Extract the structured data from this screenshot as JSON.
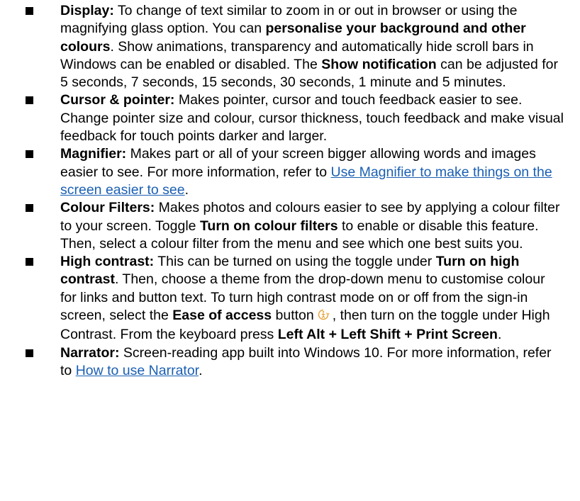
{
  "items": [
    {
      "id": "display",
      "title": "Display:",
      "t1": " To change of text similar to zoom in or out in browser or using the magnifying glass option. You can ",
      "b1": "personalise your background and other colours",
      "t2": ". Show animations, transparency and automatically hide scroll bars in Windows can be enabled or disabled. The ",
      "b2": "Show notification",
      "t3": " can be adjusted for 5 seconds, 7 seconds, 15 seconds, 30 seconds, 1 minute and 5 minutes."
    },
    {
      "id": "cursor",
      "title": "Cursor & pointer:",
      "t1": " Makes pointer, cursor and touch feedback easier to see. Change pointer size and colour, cursor thickness, touch feedback and make visual feedback for touch points darker and larger."
    },
    {
      "id": "magnifier",
      "title": "Magnifier:",
      "t1": " Makes part or all of your screen bigger allowing words and images easier to see. For more information, refer to ",
      "link": "Use Magnifier to make things on the screen easier to see",
      "t2": "."
    },
    {
      "id": "colour-filters",
      "title": "Colour Filters:",
      "t1": " Makes photos and colours easier to see by applying a colour filter to your screen. Toggle ",
      "b1": "Turn on colour filters",
      "t2": " to enable or disable this feature. Then, select a colour filter from the menu and see which one best suits you."
    },
    {
      "id": "high-contrast",
      "title": "High contrast:",
      "t1": " This can be turned on using the toggle under ",
      "b1": "Turn on high contrast",
      "t2": ". Then, choose a theme from the drop-down menu to customise colour for links and button text. To turn high contrast mode on or off from the sign-in screen, select the ",
      "b2": "Ease of access",
      "t3": " button",
      "t4": ", then turn on the toggle under High Contrast. From the keyboard press ",
      "b3": "Left Alt + Left Shift + Print Screen",
      "t5": "."
    },
    {
      "id": "narrator",
      "title": "Narrator:",
      "t1": " Screen-reading app built into Windows 10. For more information, refer to ",
      "link": "How to use Narrator",
      "t2": "."
    }
  ],
  "colors": {
    "link": "#1a5fb4",
    "text": "#000000",
    "icon": "#e8a33a"
  },
  "icons": {
    "bullet": "square-bullet-icon",
    "ease_of_access": "ease-of-access-icon"
  }
}
